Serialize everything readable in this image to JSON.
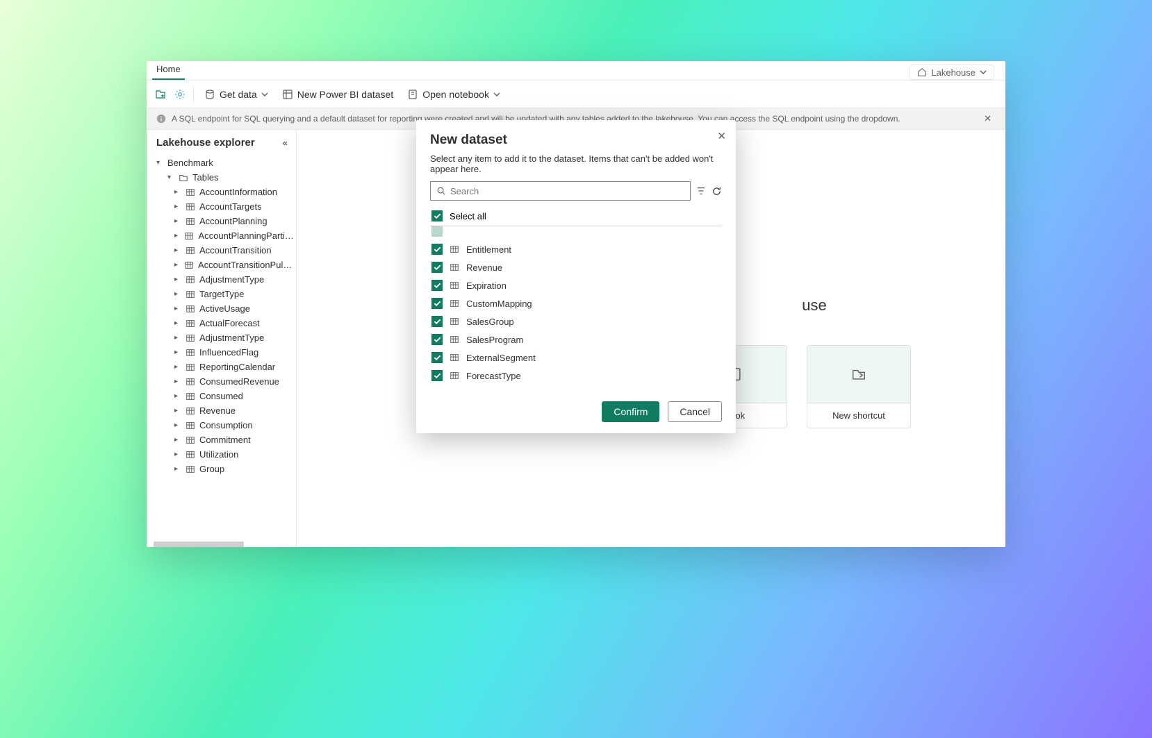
{
  "tabs": {
    "home": "Home"
  },
  "endpoint_switch": "Lakehouse",
  "toolbar": {
    "get_data": "Get data",
    "new_dataset": "New Power BI dataset",
    "open_notebook": "Open notebook"
  },
  "message_bar": "A SQL endpoint for SQL querying and a default dataset for reporting were created and will be updated with any tables added to the lakehouse. You can access the SQL endpoint using the dropdown.",
  "sidebar": {
    "title": "Lakehouse explorer",
    "root": "Benchmark",
    "group": "Tables",
    "tables": [
      "AccountInformation",
      "AccountTargets",
      "AccountPlanning",
      "AccountPlanningParticipants",
      "AccountTransition",
      "AccountTransitionPulseSurvey",
      "AdjustmentType",
      "TargetType",
      "ActiveUsage",
      "ActualForecast",
      "AdjustmentType",
      "InfluencedFlag",
      "ReportingCalendar",
      "ConsumedRevenue",
      "Consumed",
      "Revenue",
      "Consumption",
      "Commitment",
      "Utilization",
      "Group"
    ]
  },
  "main": {
    "title_fragment": "use",
    "card_notebook": "book",
    "card_shortcut": "New shortcut"
  },
  "dialog": {
    "title": "New dataset",
    "subtitle": "Select any item to add it to the dataset. Items that can't be added won't appear here.",
    "search_placeholder": "Search",
    "select_all": "Select all",
    "items": [
      "Entitlement",
      "Revenue",
      "Expiration",
      "CustomMapping",
      "SalesGroup",
      "SalesProgram",
      "ExternalSegment",
      "ForecastType"
    ],
    "confirm": "Confirm",
    "cancel": "Cancel"
  }
}
